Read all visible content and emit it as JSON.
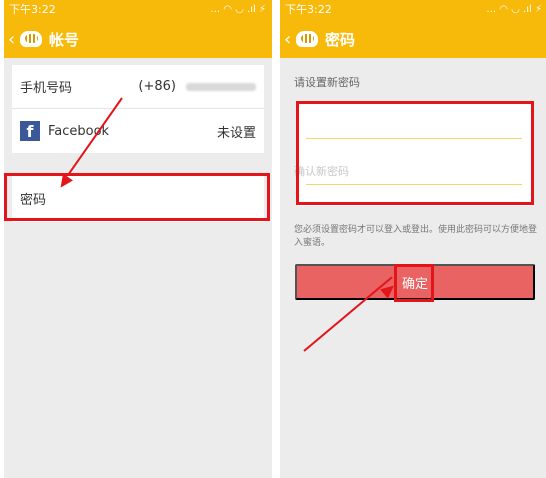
{
  "left": {
    "status_time": "下午3:22",
    "status_icons": "... ◠ ◡ .ıl ⚡",
    "title": "帐号",
    "phone_label": "手机号码",
    "phone_value": "(+86)",
    "facebook_label": "Facebook",
    "facebook_status": "未设置",
    "password_label": "密码"
  },
  "right": {
    "status_time": "下午3:22",
    "status_icons": "... ◠ ◡ .ıl ⚡",
    "title": "密码",
    "instruction": "请设置新密码",
    "confirm_placeholder": "确认新密码",
    "note": "您必须设置密码才可以登入或登出。使用此密码可以方便地登入蜜语。",
    "confirm_button": "确定"
  },
  "colors": {
    "header": "#f7b90a",
    "highlight": "#e3141a",
    "button": "#e96362"
  }
}
